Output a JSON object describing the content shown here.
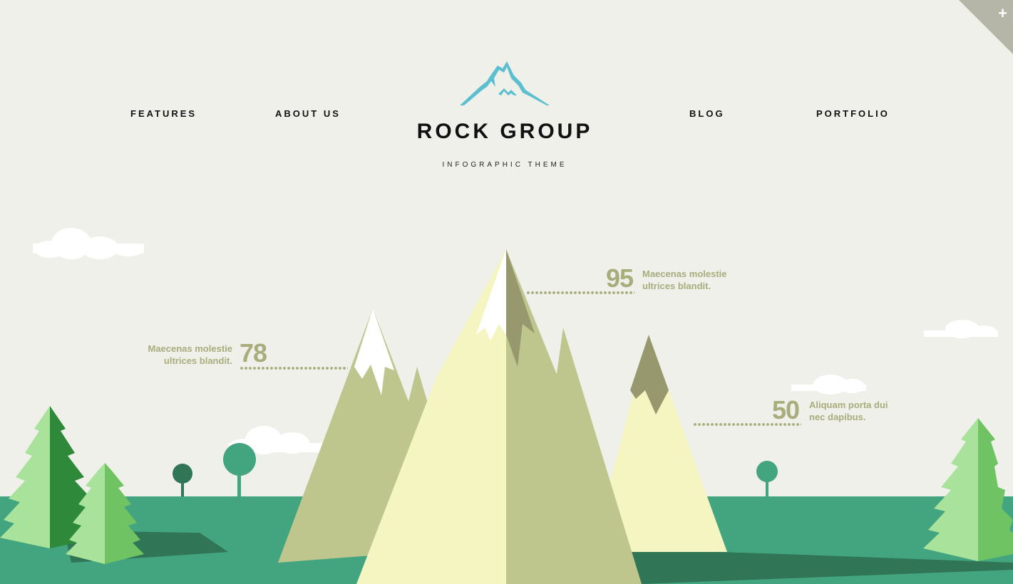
{
  "nav": {
    "features": "FEATURES",
    "about": "ABOUT US",
    "blog": "BLOG",
    "portfolio": "PORTFOLIO"
  },
  "logo": {
    "title": "ROCK GROUP",
    "subtitle": "INFOGRAPHIC THEME",
    "icon": "mountain-icon",
    "color": "#5bbfd0"
  },
  "corner": {
    "icon": "plus-icon",
    "glyph": "+"
  },
  "stats": [
    {
      "value": "95",
      "line1": "Maecenas molestie",
      "line2": "ultrices blandit."
    },
    {
      "value": "78",
      "line1": "Maecenas molestie",
      "line2": "ultrices blandit."
    },
    {
      "value": "50",
      "line1": "Aliquam porta dui",
      "line2": "nec dapibus."
    }
  ],
  "colors": {
    "background": "#f0f0eb",
    "ground": "#43a580",
    "accent_text": "#a8ad7b",
    "mountain_light": "#f5f5c2",
    "mountain_mid": "#bec68e",
    "mountain_dark": "#98986e"
  }
}
